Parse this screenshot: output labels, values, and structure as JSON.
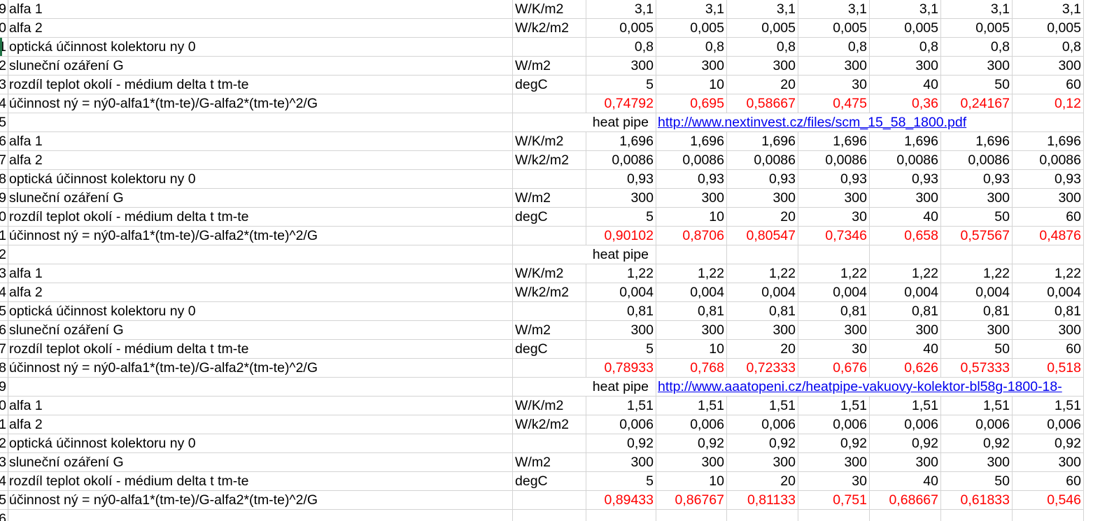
{
  "rows": [
    {
      "rn": "9",
      "label": "alfa 1",
      "unit": "W/K/m2",
      "values": [
        "3,1",
        "3,1",
        "3,1",
        "3,1",
        "3,1",
        "3,1",
        "3,1"
      ],
      "red": false
    },
    {
      "rn": "0",
      "label": "alfa 2",
      "unit": "W/k2/m2",
      "values": [
        "0,005",
        "0,005",
        "0,005",
        "0,005",
        "0,005",
        "0,005",
        "0,005"
      ],
      "red": false
    },
    {
      "rn": "1",
      "label": "optická účinnost kolektoru ny 0",
      "unit": "",
      "values": [
        "0,8",
        "0,8",
        "0,8",
        "0,8",
        "0,8",
        "0,8",
        "0,8"
      ],
      "red": false
    },
    {
      "rn": "2",
      "label": "sluneční ozáření G",
      "unit": "W/m2",
      "values": [
        "300",
        "300",
        "300",
        "300",
        "300",
        "300",
        "300"
      ],
      "red": false
    },
    {
      "rn": "3",
      "label": "rozdíl teplot okolí - médium delta t tm-te",
      "unit": "degC",
      "values": [
        "5",
        "10",
        "20",
        "30",
        "40",
        "50",
        "60"
      ],
      "red": false
    },
    {
      "rn": "4",
      "label": "účinnost ný = ný0-alfa1*(tm-te)/G-alfa2*(tm-te)^2/G",
      "unit": "",
      "values": [
        "0,74792",
        "0,695",
        "0,58667",
        "0,475",
        "0,36",
        "0,24167",
        "0,12"
      ],
      "red": true
    },
    {
      "rn": "5",
      "label": "",
      "unit": "",
      "heat": "heat pipe",
      "link": "http://www.nextinvest.cz/files/scm_15_58_1800.pdf",
      "values": [
        "",
        "",
        "",
        "",
        "",
        "",
        ""
      ],
      "red": false
    },
    {
      "rn": "6",
      "label": "alfa 1",
      "unit": "W/K/m2",
      "values": [
        "1,696",
        "1,696",
        "1,696",
        "1,696",
        "1,696",
        "1,696",
        "1,696"
      ],
      "red": false
    },
    {
      "rn": "7",
      "label": "alfa 2",
      "unit": "W/k2/m2",
      "values": [
        "0,0086",
        "0,0086",
        "0,0086",
        "0,0086",
        "0,0086",
        "0,0086",
        "0,0086"
      ],
      "red": false
    },
    {
      "rn": "8",
      "label": "optická účinnost kolektoru ny 0",
      "unit": "",
      "values": [
        "0,93",
        "0,93",
        "0,93",
        "0,93",
        "0,93",
        "0,93",
        "0,93"
      ],
      "red": false
    },
    {
      "rn": "9",
      "label": "sluneční ozáření G",
      "unit": "W/m2",
      "values": [
        "300",
        "300",
        "300",
        "300",
        "300",
        "300",
        "300"
      ],
      "red": false
    },
    {
      "rn": "0",
      "label": "rozdíl teplot okolí - médium delta t tm-te",
      "unit": "degC",
      "values": [
        "5",
        "10",
        "20",
        "30",
        "40",
        "50",
        "60"
      ],
      "red": false
    },
    {
      "rn": "1",
      "label": "účinnost ný = ný0-alfa1*(tm-te)/G-alfa2*(tm-te)^2/G",
      "unit": "",
      "values": [
        "0,90102",
        "0,8706",
        "0,80547",
        "0,7346",
        "0,658",
        "0,57567",
        "0,4876"
      ],
      "red": true
    },
    {
      "rn": "2",
      "label": "",
      "unit": "",
      "heat": "heat pipe",
      "link": "",
      "values": [
        "",
        "",
        "",
        "",
        "",
        "",
        ""
      ],
      "red": false
    },
    {
      "rn": "3",
      "label": "alfa 1",
      "unit": "W/K/m2",
      "values": [
        "1,22",
        "1,22",
        "1,22",
        "1,22",
        "1,22",
        "1,22",
        "1,22"
      ],
      "red": false
    },
    {
      "rn": "4",
      "label": "alfa 2",
      "unit": "W/k2/m2",
      "values": [
        "0,004",
        "0,004",
        "0,004",
        "0,004",
        "0,004",
        "0,004",
        "0,004"
      ],
      "red": false
    },
    {
      "rn": "5",
      "label": "optická účinnost kolektoru ny 0",
      "unit": "",
      "values": [
        "0,81",
        "0,81",
        "0,81",
        "0,81",
        "0,81",
        "0,81",
        "0,81"
      ],
      "red": false
    },
    {
      "rn": "6",
      "label": "sluneční ozáření G",
      "unit": "W/m2",
      "values": [
        "300",
        "300",
        "300",
        "300",
        "300",
        "300",
        "300"
      ],
      "red": false
    },
    {
      "rn": "7",
      "label": "rozdíl teplot okolí - médium delta t tm-te",
      "unit": "degC",
      "values": [
        "5",
        "10",
        "20",
        "30",
        "40",
        "50",
        "60"
      ],
      "red": false
    },
    {
      "rn": "8",
      "label": "účinnost ný = ný0-alfa1*(tm-te)/G-alfa2*(tm-te)^2/G",
      "unit": "",
      "values": [
        "0,78933",
        "0,768",
        "0,72333",
        "0,676",
        "0,626",
        "0,57333",
        "0,518"
      ],
      "red": true
    },
    {
      "rn": "9",
      "label": "",
      "unit": "",
      "heat": "heat pipe",
      "link": "http://www.aaatopeni.cz/heatpipe-vakuovy-kolektor-bl58g-1800-18-",
      "values": [
        "",
        "",
        "",
        "",
        "",
        "",
        ""
      ],
      "red": false
    },
    {
      "rn": "0",
      "label": "alfa 1",
      "unit": "W/K/m2",
      "values": [
        "1,51",
        "1,51",
        "1,51",
        "1,51",
        "1,51",
        "1,51",
        "1,51"
      ],
      "red": false
    },
    {
      "rn": "1",
      "label": "alfa 2",
      "unit": "W/k2/m2",
      "values": [
        "0,006",
        "0,006",
        "0,006",
        "0,006",
        "0,006",
        "0,006",
        "0,006"
      ],
      "red": false
    },
    {
      "rn": "2",
      "label": "optická účinnost kolektoru ny 0",
      "unit": "",
      "values": [
        "0,92",
        "0,92",
        "0,92",
        "0,92",
        "0,92",
        "0,92",
        "0,92"
      ],
      "red": false
    },
    {
      "rn": "3",
      "label": "sluneční ozáření G",
      "unit": "W/m2",
      "values": [
        "300",
        "300",
        "300",
        "300",
        "300",
        "300",
        "300"
      ],
      "red": false
    },
    {
      "rn": "4",
      "label": "rozdíl teplot okolí - médium delta t tm-te",
      "unit": "degC",
      "values": [
        "5",
        "10",
        "20",
        "30",
        "40",
        "50",
        "60"
      ],
      "red": false
    },
    {
      "rn": "5",
      "label": "účinnost ný = ný0-alfa1*(tm-te)/G-alfa2*(tm-te)^2/G",
      "unit": "",
      "values": [
        "0,89433",
        "0,86767",
        "0,81133",
        "0,751",
        "0,68667",
        "0,61833",
        "0,546"
      ],
      "red": true
    },
    {
      "rn": "6",
      "label": "",
      "unit": "",
      "values": [
        "",
        "",
        "",
        "",
        "",
        "",
        ""
      ],
      "red": false
    }
  ],
  "colors": {
    "red_value": "#ff0000",
    "link": "#0000ee",
    "grid": "#d4d4d4",
    "selected_row_marker": "#217346"
  }
}
